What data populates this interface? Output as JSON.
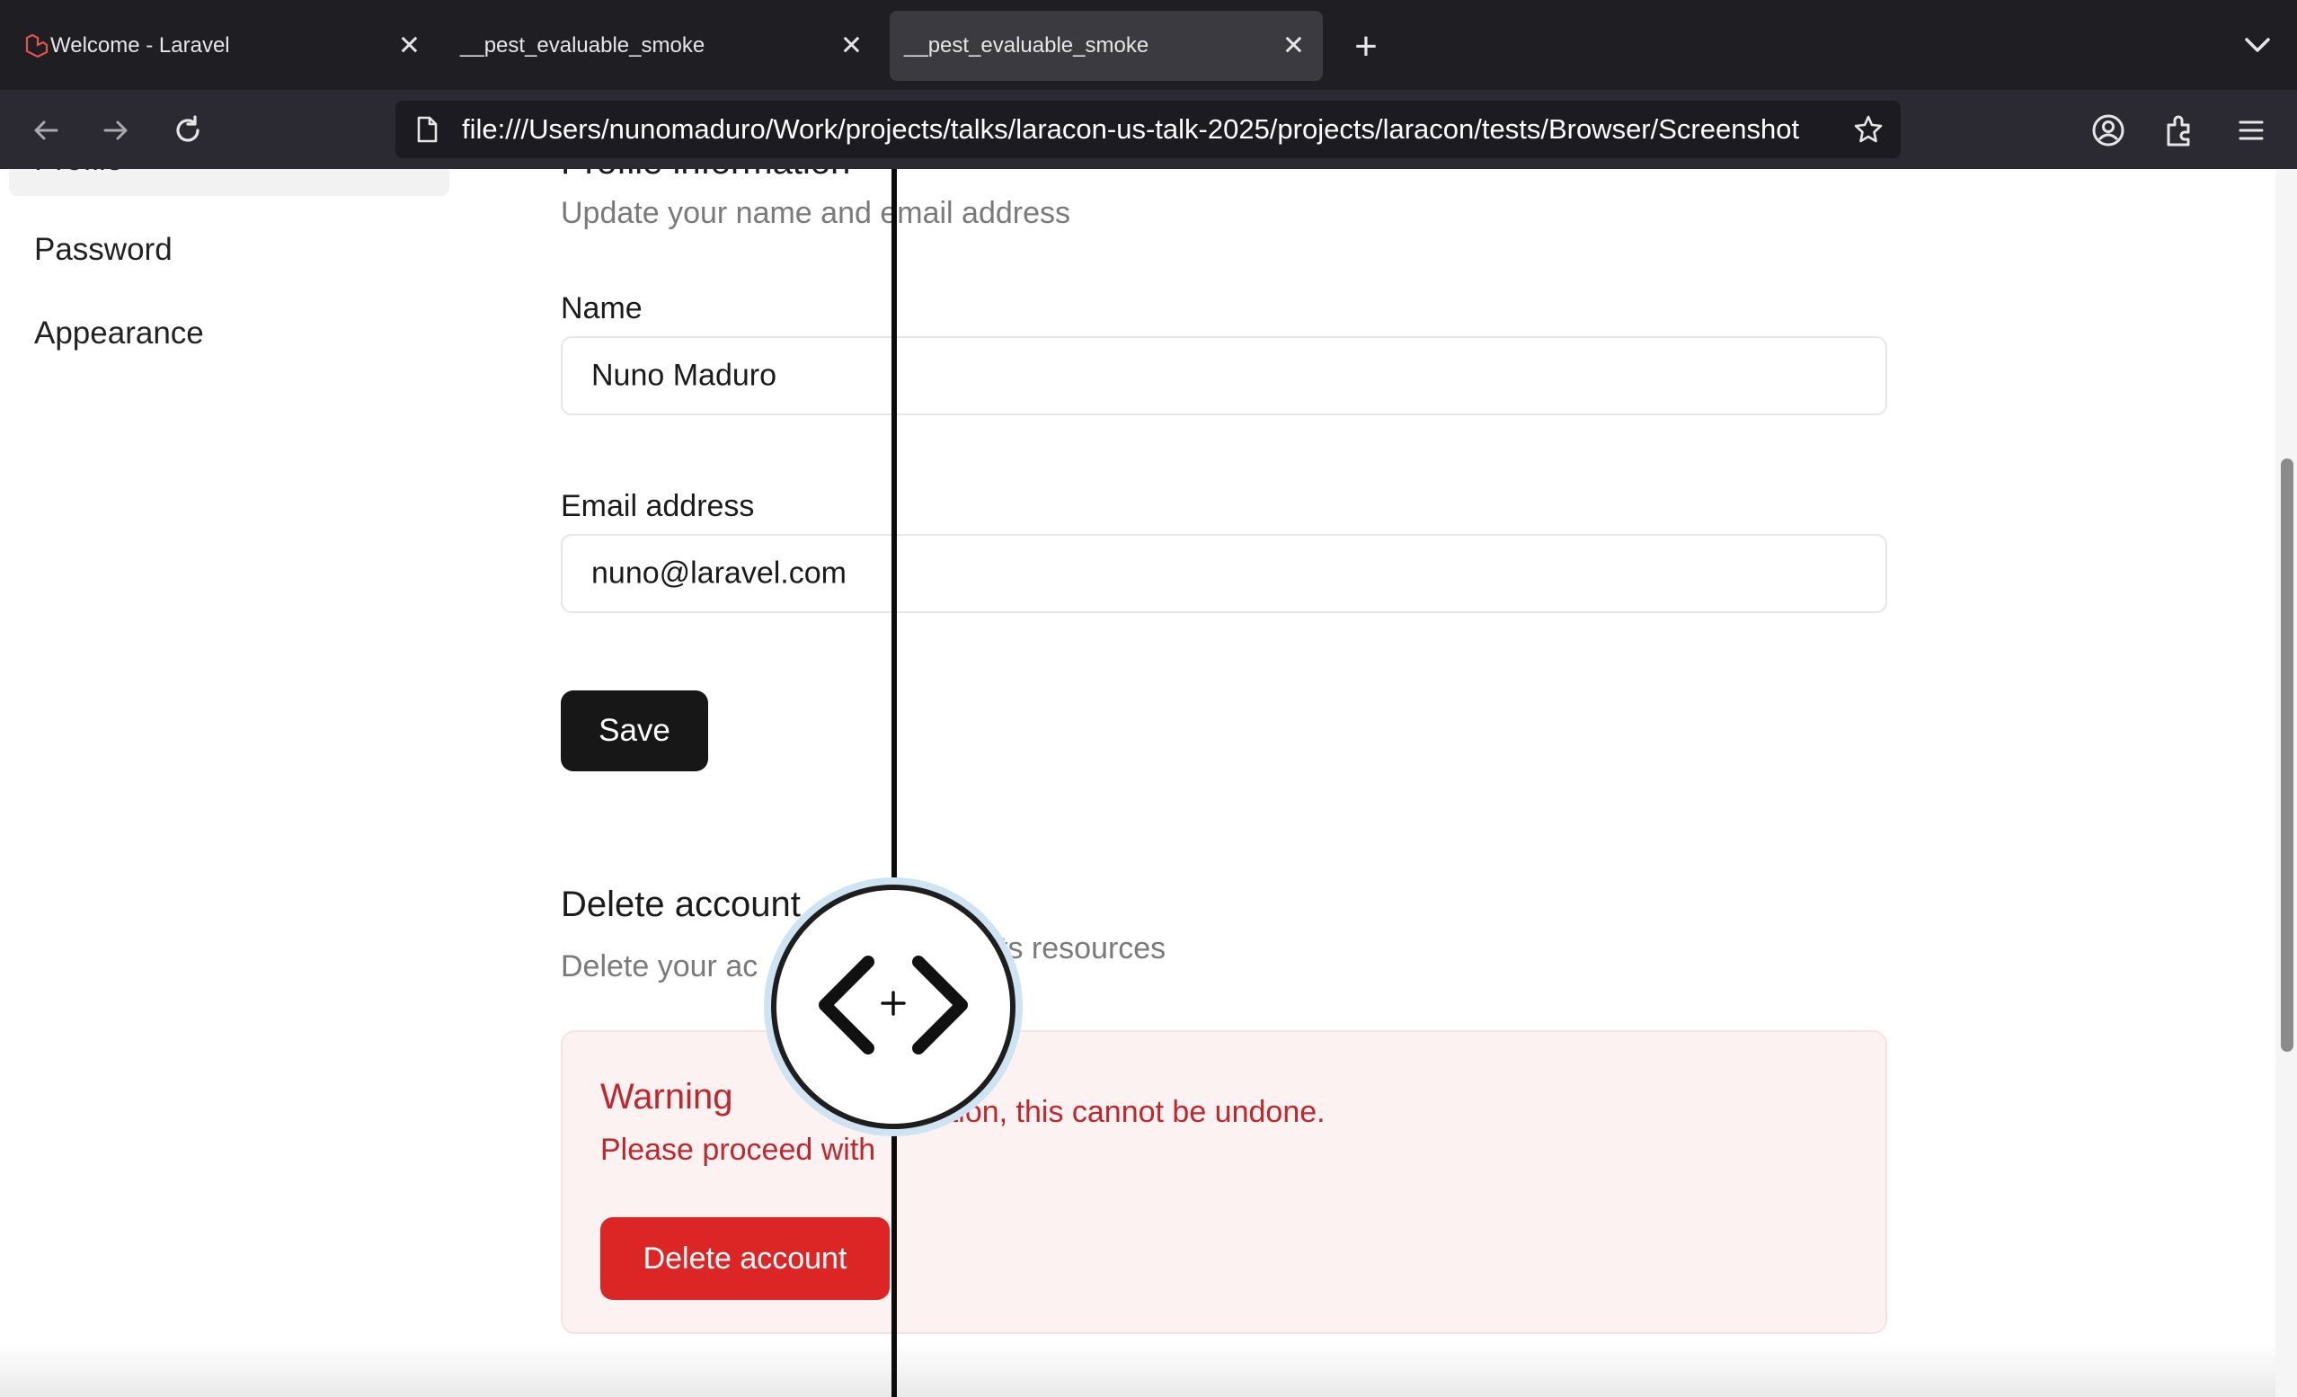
{
  "browser": {
    "tabs": [
      {
        "title": "Welcome - Laravel",
        "active": false
      },
      {
        "title": "__pest_evaluable_smoke",
        "active": false
      },
      {
        "title": "__pest_evaluable_smoke",
        "active": true
      }
    ],
    "url": "file:///Users/nunomaduro/Work/projects/talks/laracon-us-talk-2025/projects/laracon/tests/Browser/Screenshot"
  },
  "sidebar": {
    "items": [
      {
        "label": "Profile",
        "active": true
      },
      {
        "label": "Password",
        "active": false
      },
      {
        "label": "Appearance",
        "active": false
      }
    ]
  },
  "profile": {
    "heading": "Profile information",
    "subtitle": "Update your name and email address",
    "name_label": "Name",
    "name_value": "Nuno Maduro",
    "email_label": "Email address",
    "email_value": "nuno@laravel.com",
    "save_label": "Save"
  },
  "delete_section": {
    "heading": "Delete account",
    "subtitle_left": "Delete your ac",
    "subtitle_right": "ts resources",
    "warning_title": "Warning",
    "warning_text_left": "Please proceed with",
    "warning_text_right": "caution, this cannot be undone.",
    "delete_label": "Delete account"
  },
  "colors": {
    "danger": "#dc2626",
    "dark_button": "#171717",
    "warning_bg": "#fdf2f2",
    "tabbar_bg": "#1f1e23"
  }
}
